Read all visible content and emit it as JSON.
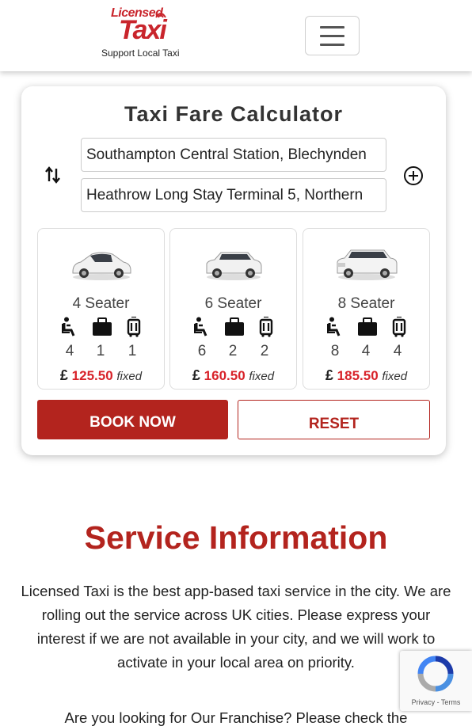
{
  "header": {
    "logo_top": "Licensed",
    "logo_main": "Taxi",
    "logo_tagline": "Support Local Taxi",
    "menu_icon": "hamburger-icon"
  },
  "calculator": {
    "title": "Taxi Fare Calculator",
    "pickup": "Southampton Central Station, Blechynden",
    "dropoff": "Heathrow Long Stay Terminal 5, Northern",
    "swap_icon": "swap-vertical-icon",
    "add_stop_icon": "plus-circle-icon",
    "vehicles": [
      {
        "name": "4 Seater",
        "passengers": "4",
        "luggage": "1",
        "hand_luggage": "1",
        "currency": "£",
        "price": "125.50",
        "price_note": "fixed"
      },
      {
        "name": "6 Seater",
        "passengers": "6",
        "luggage": "2",
        "hand_luggage": "2",
        "currency": "£",
        "price": "160.50",
        "price_note": "fixed"
      },
      {
        "name": "8 Seater",
        "passengers": "8",
        "luggage": "4",
        "hand_luggage": "4",
        "currency": "£",
        "price": "185.50",
        "price_note": "fixed"
      }
    ],
    "book_label": "BOOK NOW",
    "reset_label": "RESET"
  },
  "service_info": {
    "title": "Service Information",
    "paragraph": "Licensed Taxi is the best app-based taxi service in the city. We are rolling out the service across UK cities. Please express your interest if we are not available in your city, and we will work to activate in your local area on priority.",
    "paragraph2": "Are you looking for Our Franchise? Please check the"
  },
  "recaptcha": {
    "links": "Privacy - Terms"
  },
  "colors": {
    "brand_red": "#b3241e",
    "price_red": "#d8232a",
    "text": "#333333"
  }
}
